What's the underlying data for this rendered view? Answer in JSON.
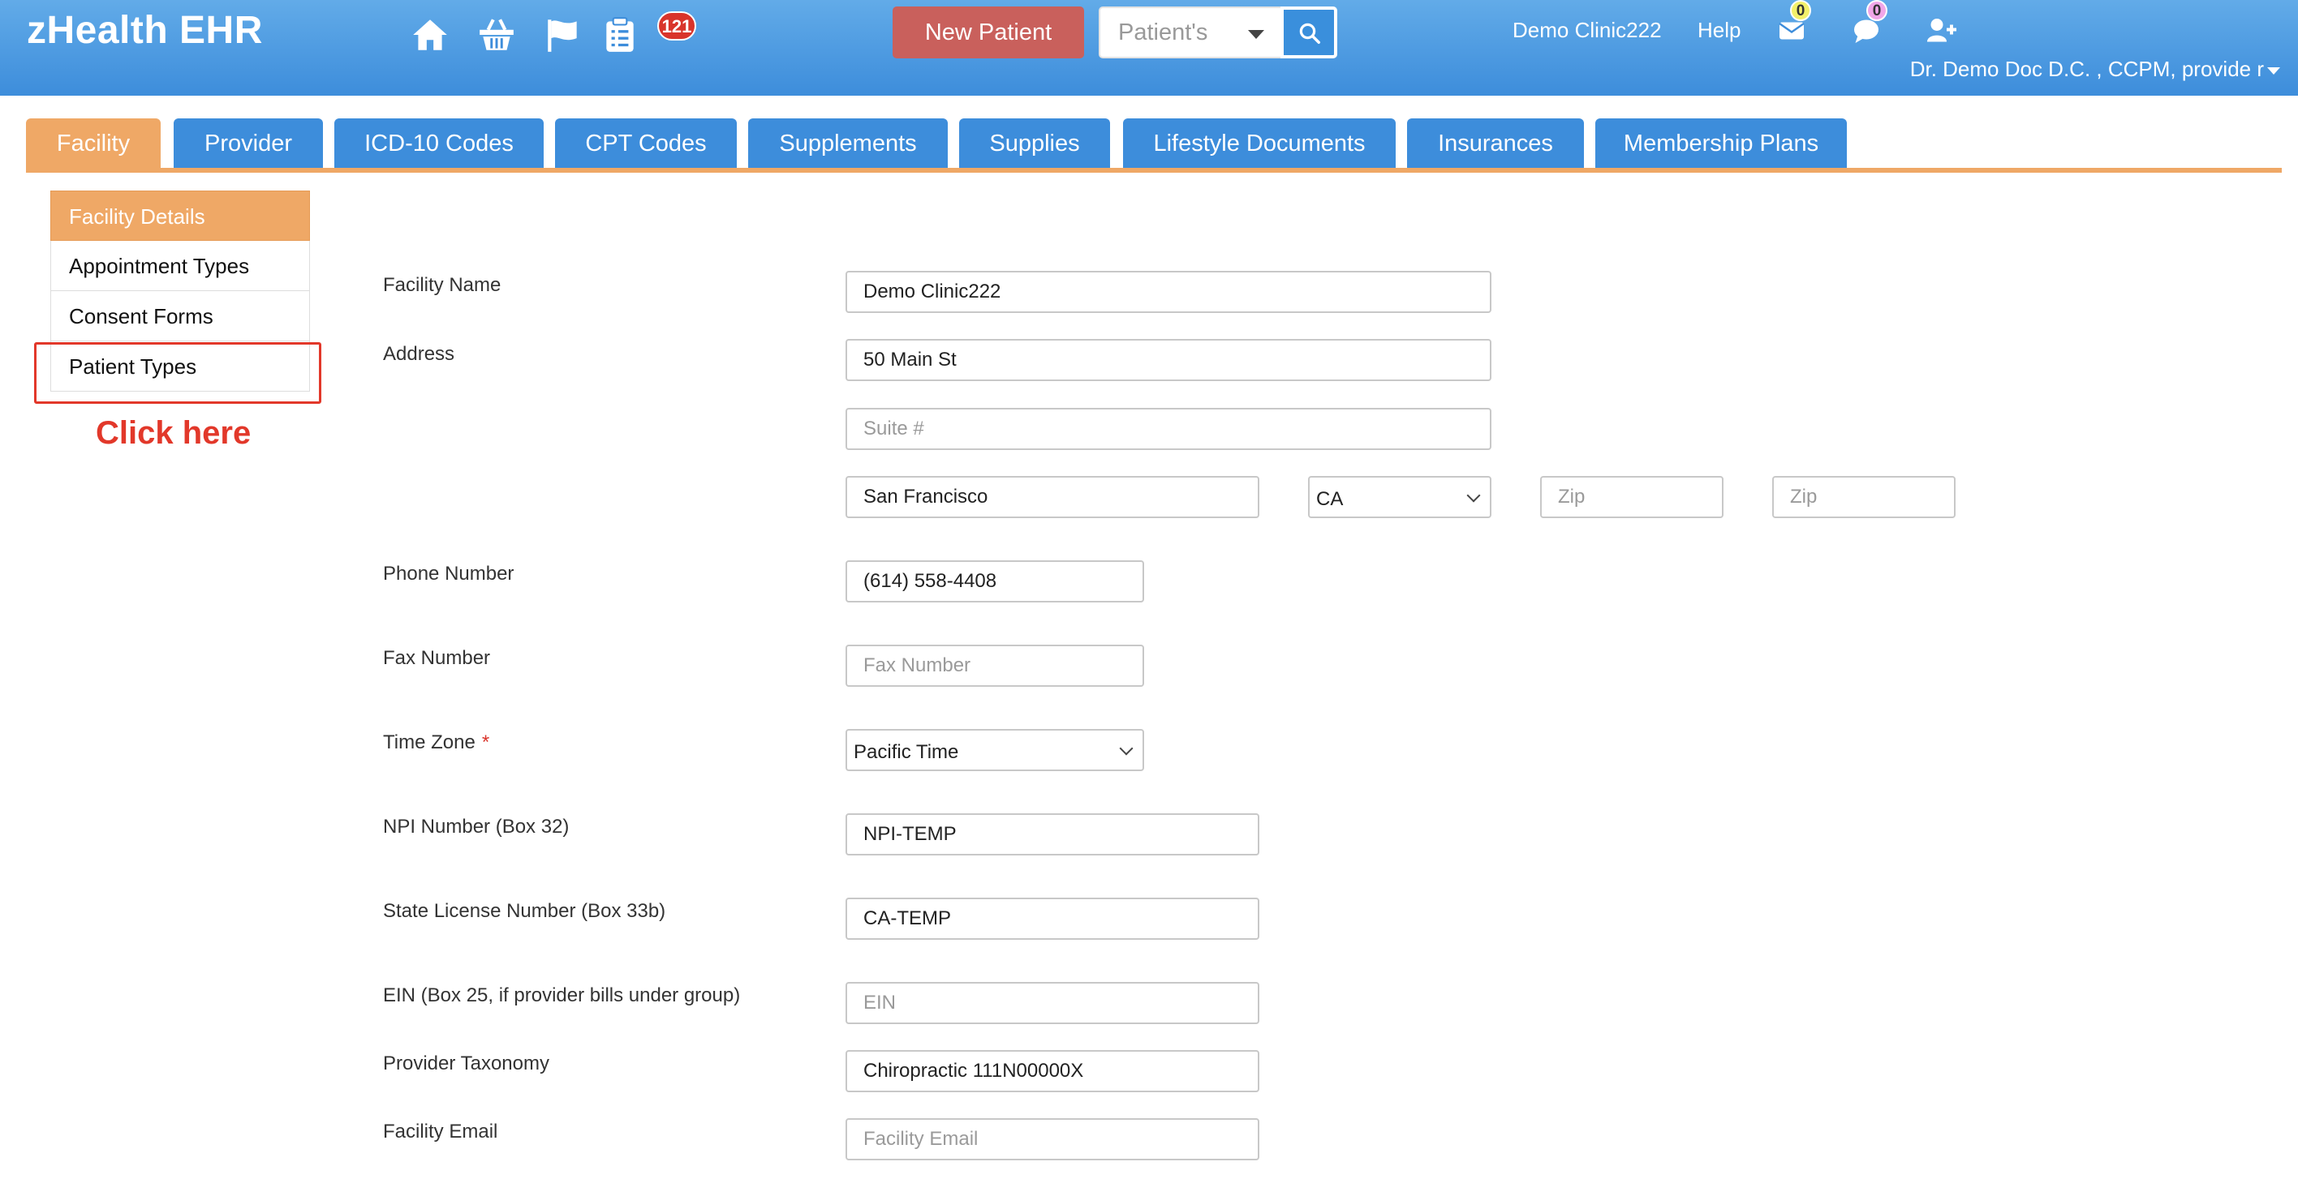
{
  "app": {
    "title": "zHealth EHR"
  },
  "header": {
    "tasks_badge": "121",
    "new_patient_label": "New Patient",
    "patient_select_value": "Patient's",
    "clinic_name": "Demo Clinic222",
    "help_label": "Help",
    "messages_count": "0",
    "chat_count": "0",
    "user_name": "Dr. Demo Doc D.C. , CCPM, provide r",
    "colors": {
      "primary": "#3d8ddb",
      "accent": "#efa866",
      "danger": "#c9605c"
    }
  },
  "tabs": [
    {
      "label": "Facility",
      "active": true
    },
    {
      "label": "Provider"
    },
    {
      "label": "ICD-10 Codes"
    },
    {
      "label": "CPT Codes"
    },
    {
      "label": "Supplements"
    },
    {
      "label": "Supplies"
    },
    {
      "label": "Lifestyle Documents"
    },
    {
      "label": "Insurances"
    },
    {
      "label": "Membership Plans"
    }
  ],
  "sidenav": {
    "items": [
      {
        "label": "Facility Details",
        "active": true
      },
      {
        "label": "Appointment Types"
      },
      {
        "label": "Consent Forms"
      },
      {
        "label": "Patient Types"
      }
    ],
    "annotation": "Click here"
  },
  "form": {
    "facility_name": {
      "label": "Facility Name",
      "value": "Demo Clinic222"
    },
    "address": {
      "label": "Address",
      "street": "50 Main St",
      "suite_placeholder": "Suite #",
      "city": "San Francisco",
      "state": "CA",
      "zip_placeholder": "Zip",
      "zip2_placeholder": "Zip"
    },
    "phone": {
      "label": "Phone Number",
      "value": "(614) 558-4408"
    },
    "fax": {
      "label": "Fax Number",
      "placeholder": "Fax Number"
    },
    "time_zone": {
      "label": "Time Zone",
      "required_mark": "*",
      "value": "Pacific Time"
    },
    "npi": {
      "label": "NPI Number (Box 32)",
      "value": "NPI-TEMP"
    },
    "state_license": {
      "label": "State License Number (Box 33b)",
      "value": "CA-TEMP"
    },
    "ein": {
      "label": "EIN (Box 25, if provider bills under group)",
      "placeholder": "EIN"
    },
    "taxonomy": {
      "label": "Provider Taxonomy",
      "value": "Chiropractic 111N00000X"
    },
    "email": {
      "label": "Facility Email",
      "placeholder": "Facility Email"
    }
  }
}
